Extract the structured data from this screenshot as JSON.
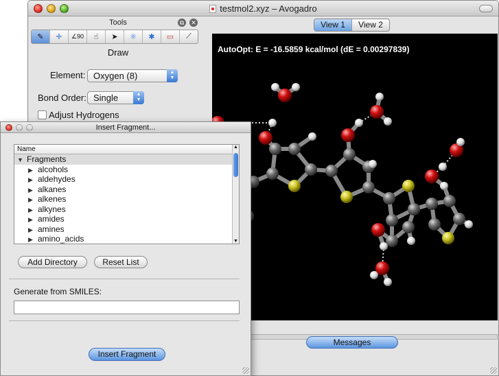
{
  "window": {
    "title": "testmol2.xyz – Avogadro"
  },
  "tools": {
    "header": "Tools",
    "mode": "Draw",
    "buttons": [
      "draw-pen",
      "navigate",
      "measure",
      "manipulate",
      "select",
      "autorotate",
      "autoopt",
      "align",
      "bond-centric"
    ],
    "element_label": "Element:",
    "element_value": "Oxygen (8)",
    "bond_label": "Bond Order:",
    "bond_value": "Single",
    "adjust_hydrogens": "Adjust Hydrogens"
  },
  "tabs": [
    {
      "label": "View 1",
      "active": true
    },
    {
      "label": "View 2",
      "active": false
    }
  ],
  "viewport": {
    "autoopt_text": "AutoOpt: E = -16.5859 kcal/mol (dE = 0.00297839)",
    "atom_colors": {
      "carbon": "#6b6b6b",
      "oxygen": "#d01010",
      "sulfur": "#c8c020",
      "hydrogen": "#e8e8e8"
    }
  },
  "messages_button": "Messages",
  "dialog": {
    "title": "Insert Fragment...",
    "tree_header": "Name",
    "root": "Fragments",
    "items": [
      "alcohols",
      "aldehydes",
      "alkanes",
      "alkenes",
      "alkynes",
      "amides",
      "amines",
      "amino_acids"
    ],
    "add_directory": "Add Directory",
    "reset_list": "Reset List",
    "smiles_label": "Generate from SMILES:",
    "smiles_value": "",
    "insert_button": "Insert Fragment"
  }
}
